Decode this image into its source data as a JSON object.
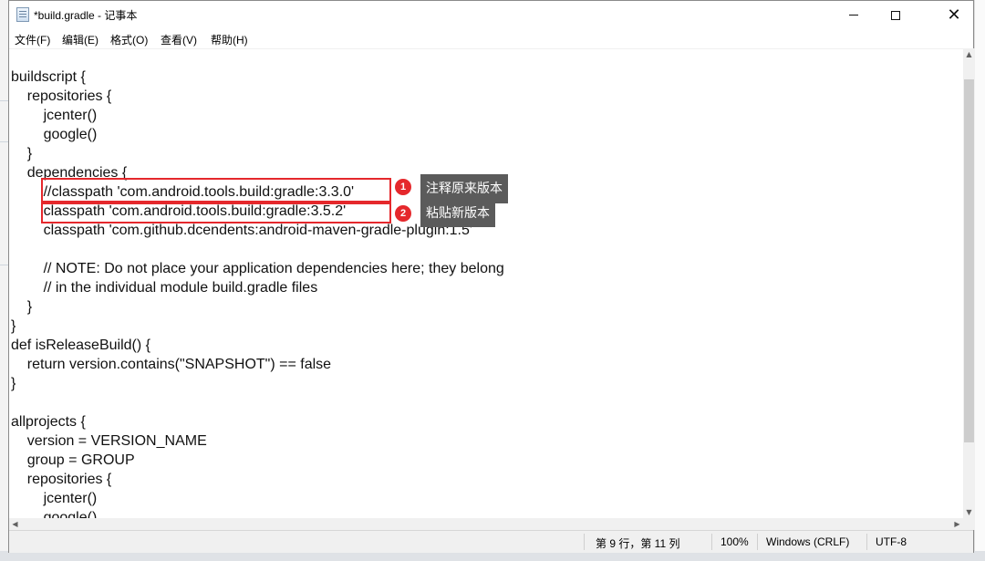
{
  "window": {
    "title": "*build.gradle - 记事本",
    "icon": "notepad-icon"
  },
  "menu": [
    "文件(F)",
    "编辑(E)",
    "格式(O)",
    "查看(V)",
    "帮助(H)"
  ],
  "editor": {
    "lines": [
      "buildscript {",
      "    repositories {",
      "        jcenter()",
      "        google()",
      "    }",
      "    dependencies {",
      "        //classpath 'com.android.tools.build:gradle:3.3.0'",
      "        classpath 'com.android.tools.build:gradle:3.5.2'",
      "        classpath 'com.github.dcendents:android-maven-gradle-plugin:1.5'",
      "",
      "        // NOTE: Do not place your application dependencies here; they belong",
      "        // in the individual module build.gradle files",
      "    }",
      "}",
      "def isReleaseBuild() {",
      "    return version.contains(\"SNAPSHOT\") == false",
      "}",
      "",
      "allprojects {",
      "    version = VERSION_NAME",
      "    group = GROUP",
      "    repositories {",
      "        jcenter()",
      "        google()"
    ]
  },
  "annotations": [
    {
      "number": "1",
      "text": "注释原来版本"
    },
    {
      "number": "2",
      "text": "粘贴新版本"
    }
  ],
  "status": {
    "position": "第 9 行，第 11 列",
    "zoom": "100%",
    "line_ending": "Windows (CRLF)",
    "encoding": "UTF-8"
  },
  "accent_color": "#e5282c"
}
